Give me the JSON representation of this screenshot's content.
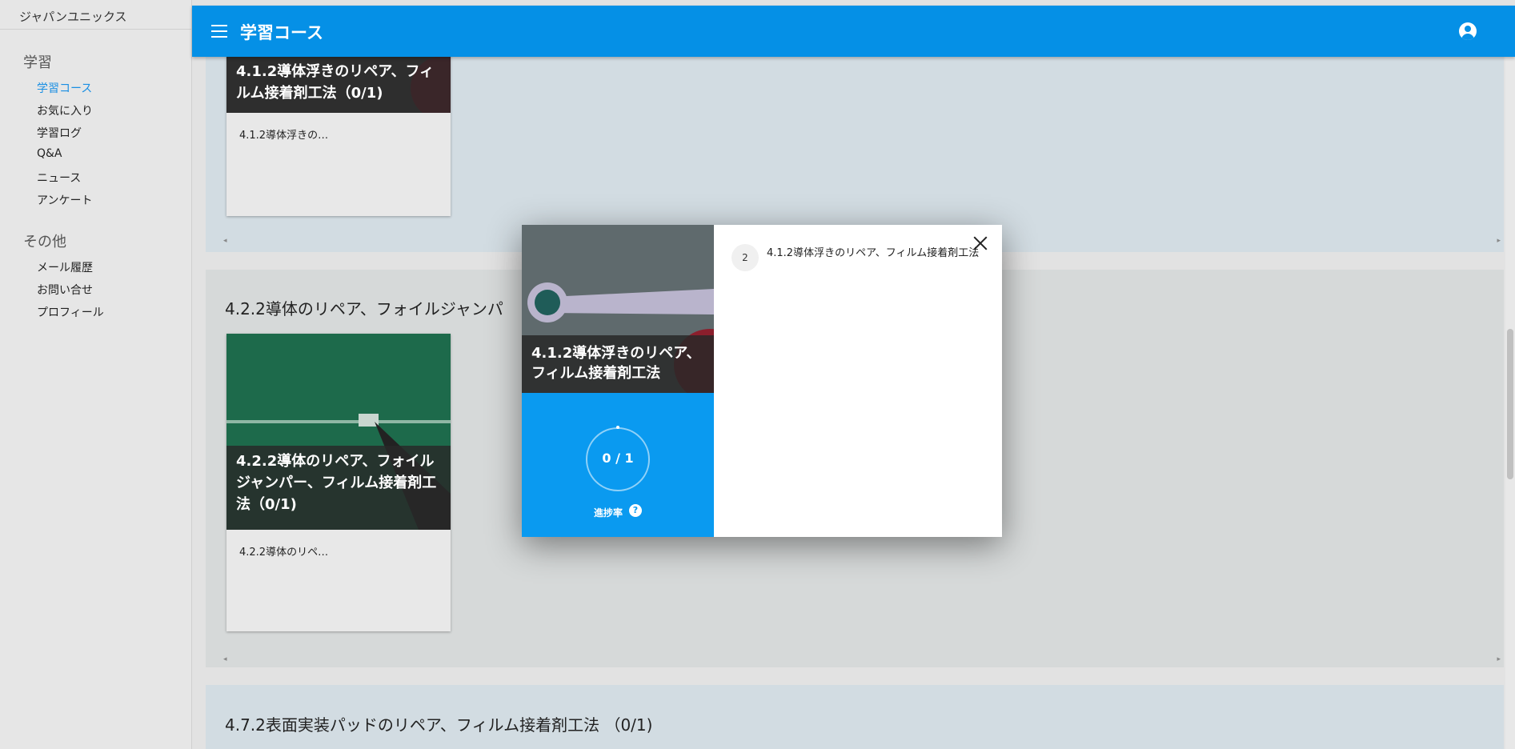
{
  "sidebar": {
    "org": "ジャパンユニックス",
    "sections": [
      {
        "title": "学習",
        "items": [
          "学習コース",
          "お気に入り",
          "学習ログ",
          "Q&A",
          "ニュース",
          "アンケート"
        ]
      },
      {
        "title": "その他",
        "items": [
          "メール履歴",
          "お問い合せ",
          "プロフィール"
        ]
      }
    ],
    "active_item": "学習コース"
  },
  "appbar": {
    "title": "学習コース",
    "menu_icon": "menu-icon",
    "account_icon": "account-circle-icon"
  },
  "panels": [
    {
      "card": {
        "title": "4.1.2導体浮きのリペア、フィルム接着剤工法（0/1)",
        "desc": "4.1.2導体浮きの…"
      }
    },
    {
      "title": "4.2.2導体のリペア、フォイルジャンパ",
      "card": {
        "title": "4.2.2導体のリペア、フォイルジャンパー、フィルム接着剤工法（0/1)",
        "desc": "4.2.2導体のリペ…"
      }
    },
    {
      "title": "4.7.2表面実装パッドのリペア、フィルム接着剤工法 （0/1)"
    }
  ],
  "modal": {
    "title": "4.1.2導体浮きのリペア、フィルム接着剤工法",
    "progress_text": "0 / 1",
    "progress_label": "進捗率",
    "progress_fraction": 0,
    "help_icon": "?",
    "lesson": {
      "number": "2",
      "title": "4.1.2導体浮きのリペア、フィルム接着剤工法"
    }
  },
  "colors": {
    "appbar": "#0590e6",
    "progress_panel": "#0a9af0",
    "active_nav": "#1a8fe3"
  }
}
